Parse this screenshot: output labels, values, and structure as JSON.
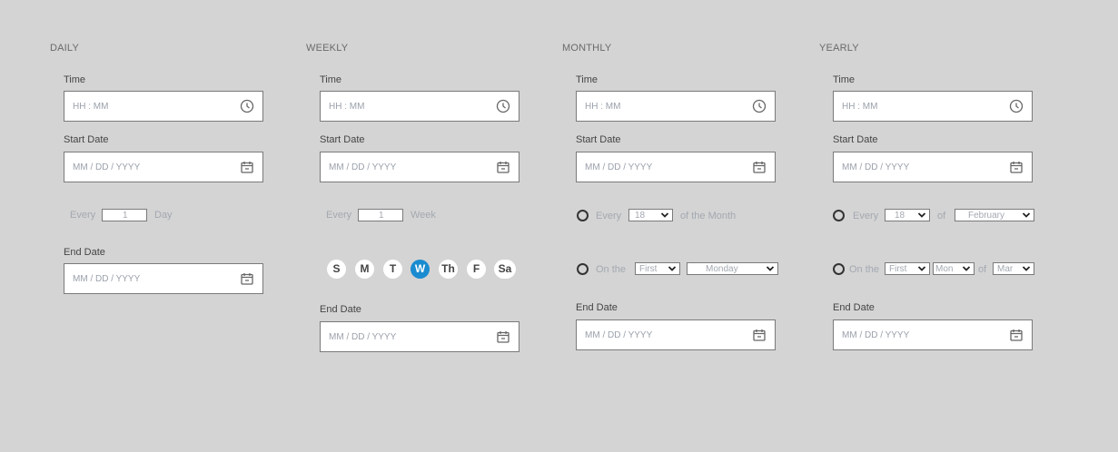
{
  "placeholders": {
    "time": "HH : MM",
    "date": "MM / DD / YYYY"
  },
  "labels": {
    "time": "Time",
    "start_date": "Start Date",
    "end_date": "End Date"
  },
  "daily": {
    "title": "DAILY",
    "every": "Every",
    "every_value": "1",
    "unit": "Day"
  },
  "weekly": {
    "title": "WEEKLY",
    "every": "Every",
    "every_value": "1",
    "unit": "Week",
    "days": [
      "S",
      "M",
      "T",
      "W",
      "Th",
      "F",
      "Sa"
    ],
    "selected_day": "W"
  },
  "monthly": {
    "title": "MONTHLY",
    "every": "Every",
    "every_day": "18",
    "of_the_month": "of the Month",
    "on_the": "On the",
    "ordinal": "First",
    "weekday": "Monday"
  },
  "yearly": {
    "title": "YEARLY",
    "every": "Every",
    "every_day": "18",
    "of": "of",
    "month": "February",
    "on_the": "On the",
    "ordinal": "First",
    "weekday": "Mon",
    "of2": "of",
    "month2": "Mar"
  },
  "icons": {
    "clock": "clock-icon",
    "calendar": "calendar-icon",
    "chevron": "chevron-down-icon"
  },
  "colors": {
    "background": "#d4d4d4",
    "accent": "#1a8bd0"
  }
}
